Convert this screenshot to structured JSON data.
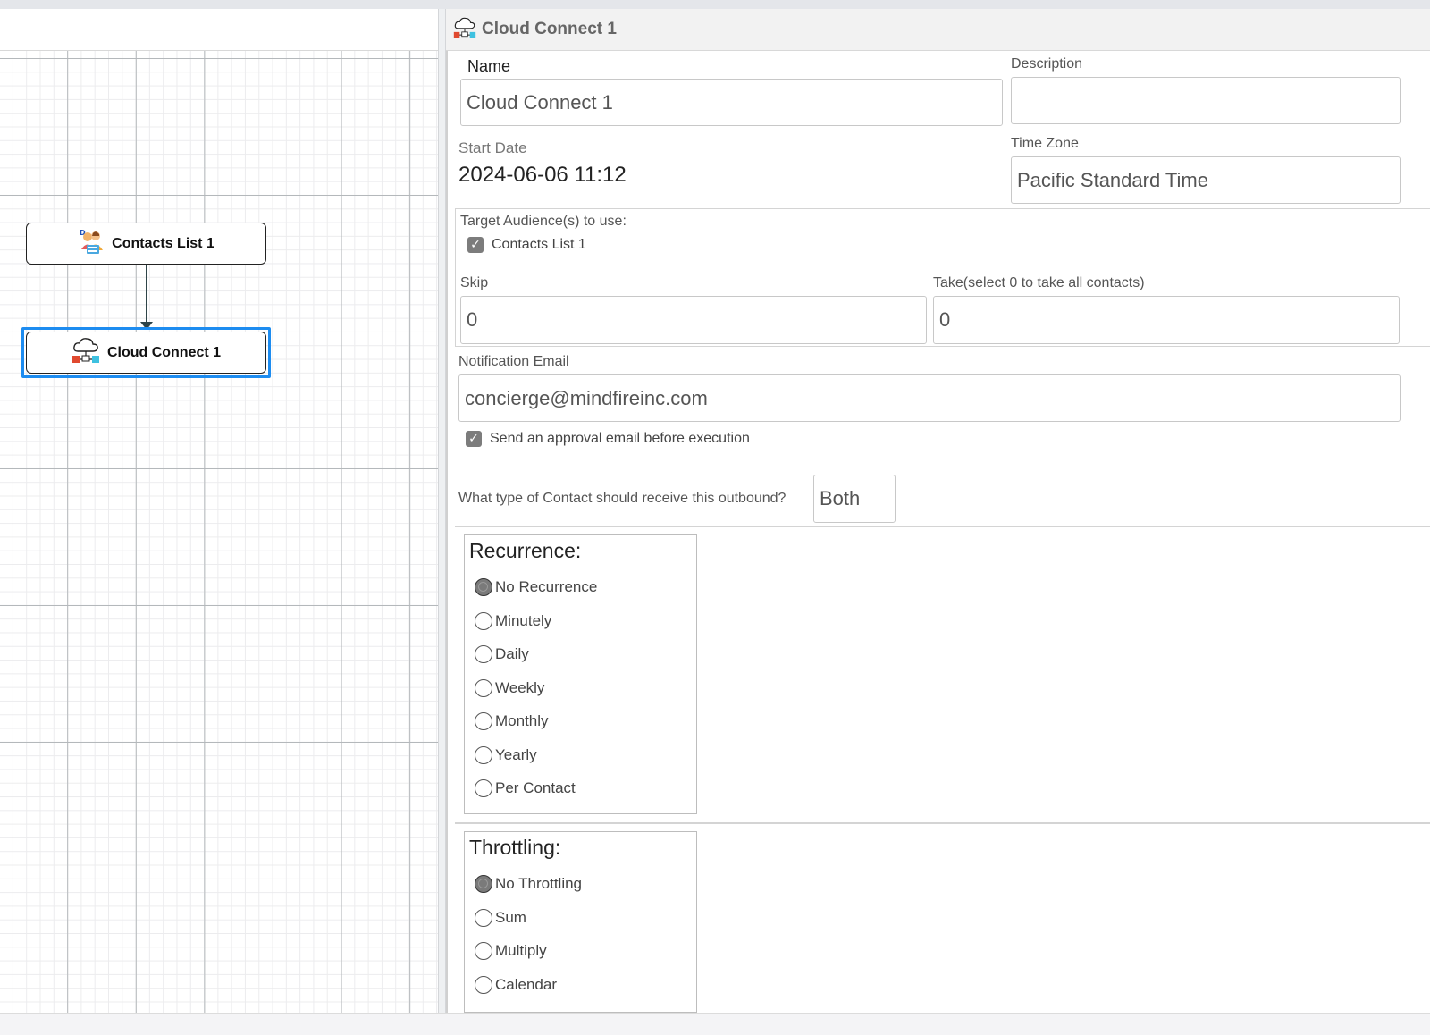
{
  "canvas": {
    "nodes": [
      {
        "label": "Contacts List 1",
        "icon": "contacts-list-icon"
      },
      {
        "label": "Cloud Connect 1",
        "icon": "cloud-connect-icon",
        "selected": true
      }
    ]
  },
  "panel": {
    "title": "Cloud Connect 1",
    "name_label": "Name",
    "name_value": "Cloud Connect 1",
    "description_label": "Description",
    "description_value": "",
    "start_date_label": "Start Date",
    "start_date_value": "2024-06-06 11:12",
    "time_zone_label": "Time Zone",
    "time_zone_value": "Pacific Standard Time",
    "audience_label": "Target Audience(s) to use:",
    "audience_items": [
      {
        "label": "Contacts List 1",
        "checked": true
      }
    ],
    "skip_label": "Skip",
    "skip_value": "0",
    "take_label": "Take(select 0 to take all contacts)",
    "take_value": "0",
    "notification_label": "Notification Email",
    "notification_value": "concierge@mindfireinc.com",
    "approval_label": "Send an approval email before execution",
    "approval_checked": true,
    "contact_type_label": "What type of Contact should receive this outbound?",
    "contact_type_value": "Both",
    "recurrence": {
      "title": "Recurrence:",
      "options": [
        "No Recurrence",
        "Minutely",
        "Daily",
        "Weekly",
        "Monthly",
        "Yearly",
        "Per Contact"
      ],
      "selected": "No Recurrence"
    },
    "throttling": {
      "title": "Throttling:",
      "options": [
        "No Throttling",
        "Sum",
        "Multiply",
        "Calendar"
      ],
      "selected": "No Throttling"
    }
  },
  "colors": {
    "selection_outline": "#1d8cf0",
    "connector": "#2e4448"
  }
}
